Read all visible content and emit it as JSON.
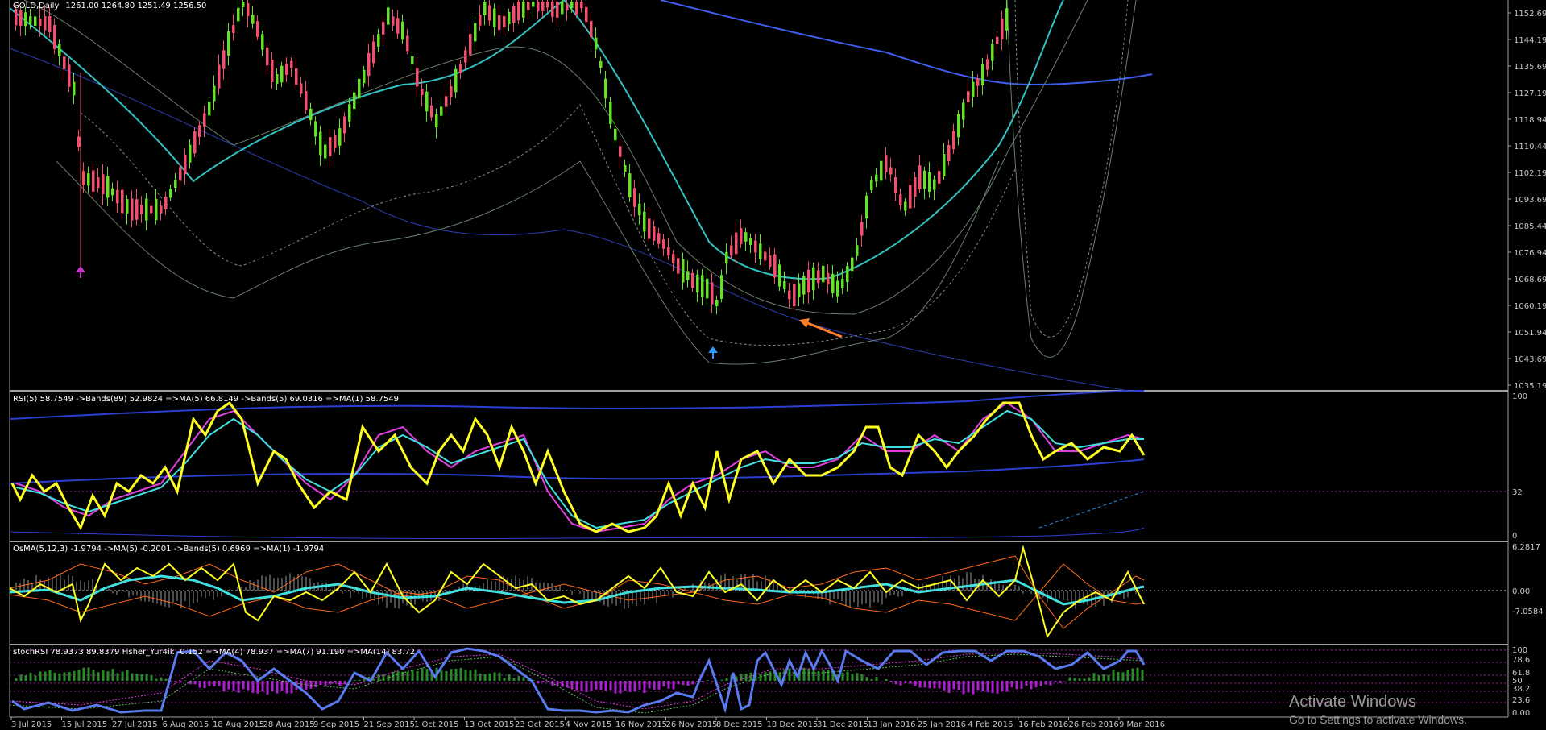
{
  "colors": {
    "bull": "#66e02a",
    "bear": "#f0506e",
    "upper_ma": "#33c2c2",
    "long_ma": "#3c5ee8",
    "rsi_line": "#ffff22",
    "magenta": "#e040e0",
    "cyan": "#40e0e0",
    "orange": "#ff7f2a",
    "dashed": "#8b8b8b",
    "hist_green": "#2a8a2a",
    "hist_purple": "#aa22cc",
    "stoch_blue": "#5a7af0"
  },
  "main": {
    "title": "GOLD,Daily",
    "ohlc": "1261.00  1264.80  1251.49  1256.50",
    "price_ticks": [
      "1152.69",
      "1144.19",
      "1135.69",
      "1127.19",
      "1118.94",
      "1110.44",
      "1102.19",
      "1093.69",
      "1085.44",
      "1076.94",
      "1068.69",
      "1060.19",
      "1051.94",
      "1043.69",
      "1035.19"
    ]
  },
  "rsi": {
    "label": "RSI(5) 58.7549  ->Bands(89) 52.9824  =>MA(5) 66.8149  ->Bands(5) 69.0316  =>MA(1) 58.7549",
    "ticks": [
      "100",
      "32",
      "0"
    ]
  },
  "osma": {
    "label": "OsMA(5,12,3) -1.9794  ->MA(5) -0.2001  ->Bands(5) 0.6969  =>MA(1) -1.9794",
    "ticks": [
      "6.2817",
      "0.00",
      "-7.0584"
    ]
  },
  "stoch": {
    "label": "stochRSI 78.9373 89.8379  Fisher_Yur4ik -0.152  =>MA(4) 78.937  =>MA(7) 91.190  =>MA(14) 83.72",
    "ticks": [
      "100",
      "78.6",
      "61.8",
      "50",
      "38.2",
      "23.6",
      "0.00"
    ]
  },
  "dates": [
    "3 Jul 2015",
    "15 Jul 2015",
    "27 Jul 2015",
    "6 Aug 2015",
    "18 Aug 2015",
    "28 Aug 2015",
    "9 Sep 2015",
    "21 Sep 2015",
    "1 Oct 2015",
    "13 Oct 2015",
    "23 Oct 2015",
    "4 Nov 2015",
    "16 Nov 2015",
    "26 Nov 2015",
    "8 Dec 2015",
    "18 Dec 2015",
    "31 Dec 2015",
    "13 Jan 2016",
    "25 Jan 2016",
    "4 Feb 2016",
    "16 Feb 2016",
    "26 Feb 2016",
    "9 Mar 2016"
  ],
  "watermark": {
    "title": "Activate Windows",
    "subtitle": "Go to Settings to activate Windows."
  }
}
